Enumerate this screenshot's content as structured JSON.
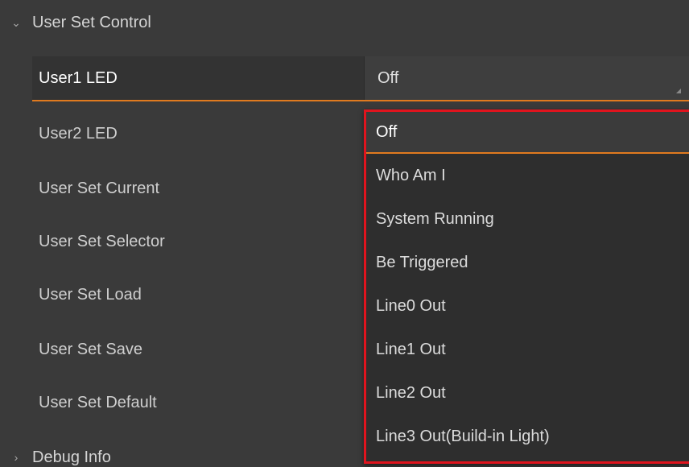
{
  "group_top": {
    "arrow": "⌄",
    "label": "User Set Control"
  },
  "rows": [
    {
      "label": "User1 LED",
      "value": "Off"
    },
    {
      "label": "User2 LED"
    },
    {
      "label": "User Set Current"
    },
    {
      "label": "User Set Selector"
    },
    {
      "label": "User Set Load"
    },
    {
      "label": "User Set Save"
    },
    {
      "label": "User Set Default"
    }
  ],
  "group_bottom": {
    "arrow": "›",
    "label": "Debug Info"
  },
  "dropdown": {
    "selected": "Off",
    "options": [
      "Off",
      "Who Am I",
      "System Running",
      "Be Triggered",
      "Line0 Out",
      "Line1 Out",
      "Line2 Out",
      "Line3 Out(Build-in Light)"
    ]
  },
  "colors": {
    "accent": "#e07a1f",
    "highlight_border": "#e0141e",
    "background": "#3a3a3a"
  },
  "icons": {
    "expanded": "chevron-down-icon",
    "collapsed": "chevron-right-icon",
    "resize": "resize-corner-icon"
  }
}
